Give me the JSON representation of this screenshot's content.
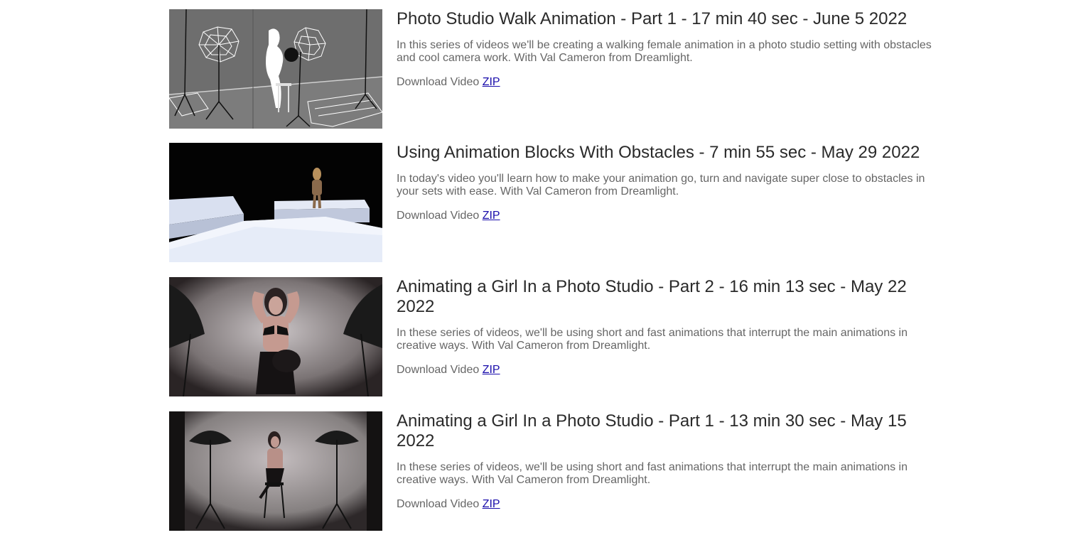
{
  "videos": [
    {
      "title": "Photo Studio Walk Animation - Part 1 - 17 min 40 sec - June 5 2022",
      "description": "In this series of videos we'll be creating a walking female animation in a photo studio setting with obstacles and cool camera work. With Val Cameron from Dreamlight.",
      "download_label": "Download Video",
      "link_label": "ZIP",
      "thumbnail": "wireframe-studio-walk-thumbnail"
    },
    {
      "title": "Using Animation Blocks With Obstacles - 7 min 55 sec - May 29 2022",
      "description": "In today's video you'll learn how to make your animation go, turn and navigate super close to obstacles in your sets with ease. With Val Cameron from Dreamlight.",
      "download_label": "Download Video",
      "link_label": "ZIP",
      "thumbnail": "white-blocks-figure-thumbnail"
    },
    {
      "title": "Animating a Girl In a Photo Studio - Part 2 - 16 min 13 sec - May 22 2022",
      "description": "In these series of videos, we'll be using short and fast animations that interrupt the main animations in creative ways. With Val Cameron from Dreamlight.",
      "download_label": "Download Video",
      "link_label": "ZIP",
      "thumbnail": "photo-studio-umbrellas-closeup-thumbnail"
    },
    {
      "title": "Animating a Girl In a Photo Studio - Part 1 - 13 min 30 sec - May 15 2022",
      "description": "In these series of videos, we'll be using short and fast animations that interrupt the main animations in creative ways. With Val Cameron from Dreamlight.",
      "download_label": "Download Video",
      "link_label": "ZIP",
      "thumbnail": "photo-studio-umbrellas-stool-thumbnail"
    }
  ],
  "colors": {
    "title": "#2a2a2a",
    "text": "#666666",
    "link": "#1a0dab"
  }
}
